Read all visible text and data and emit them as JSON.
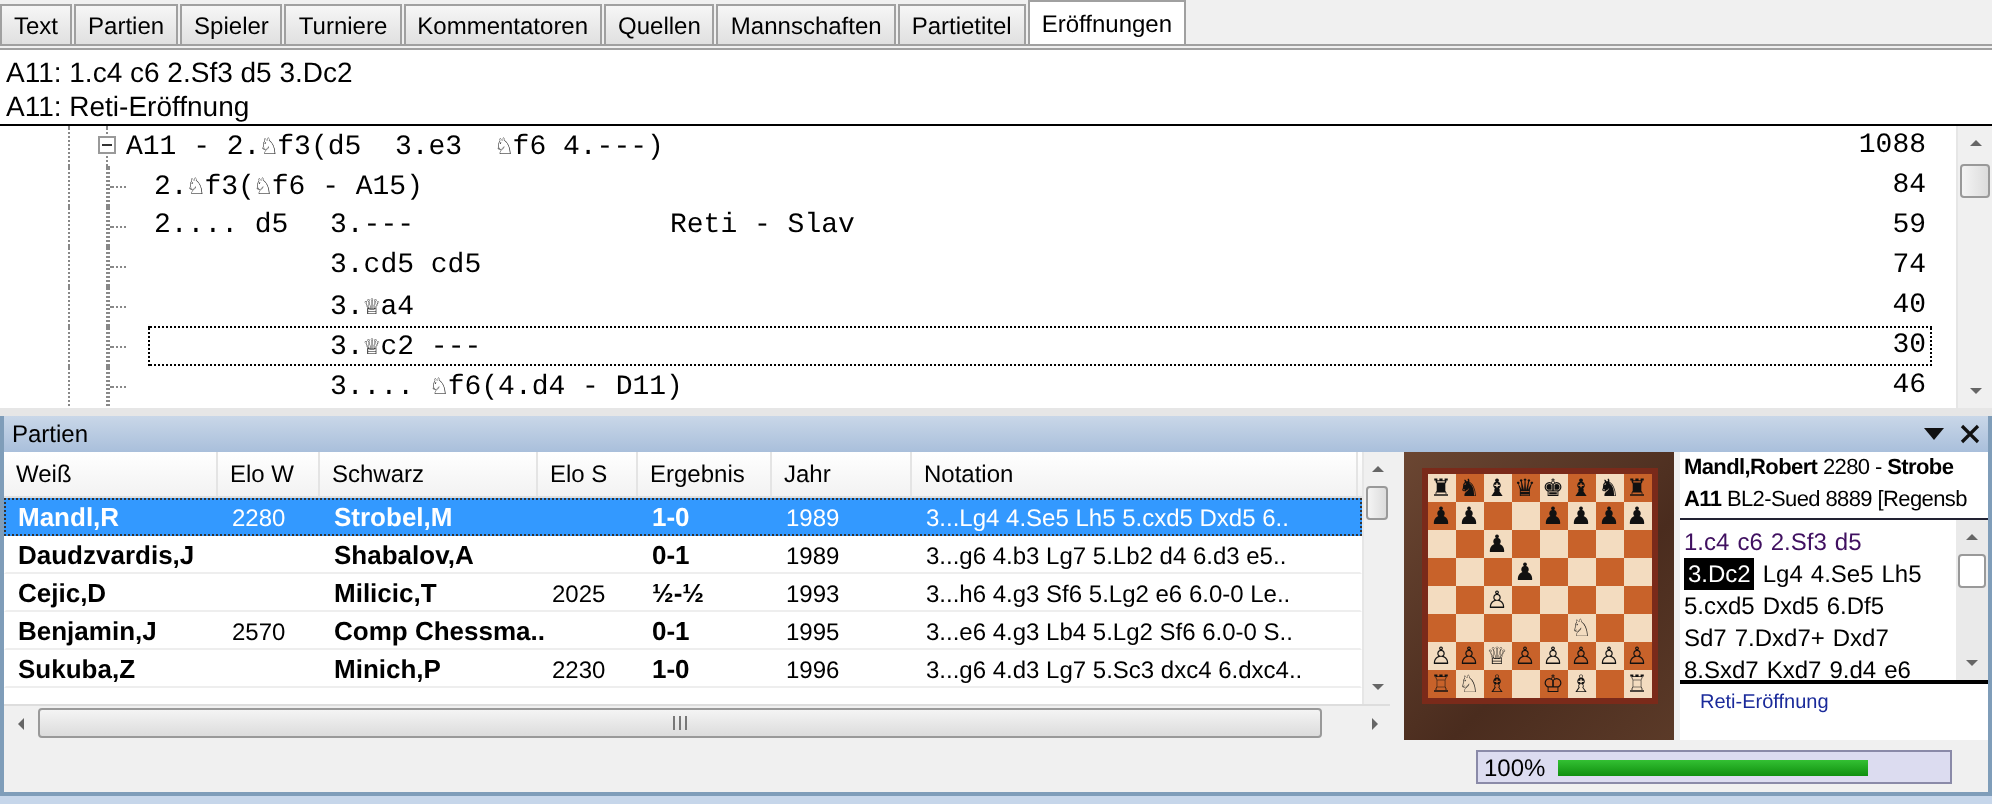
{
  "tabs": [
    {
      "label": "Text",
      "selected": false
    },
    {
      "label": "Partien",
      "selected": false
    },
    {
      "label": "Spieler",
      "selected": false
    },
    {
      "label": "Turniere",
      "selected": false
    },
    {
      "label": "Kommentatoren",
      "selected": false
    },
    {
      "label": "Quellen",
      "selected": false
    },
    {
      "label": "Mannschaften",
      "selected": false
    },
    {
      "label": "Partietitel",
      "selected": false
    },
    {
      "label": "Eröffnungen",
      "selected": true
    }
  ],
  "header_lines": [
    "A11: 1.c4 c6 2.Sf3 d5 3.Dc2",
    "A11: Reti-Eröffnung"
  ],
  "tree": [
    {
      "text": "A11 - 2.♘f3(d5  3.e3  ♘f6 4.---)",
      "count": "1088",
      "expanded": true,
      "selected": false,
      "children": [
        {
          "text": "2.♘f3(♘f6 - A15)",
          "count": "84",
          "selected": false
        },
        {
          "text": "2.... d5",
          "move": "3.---",
          "name": "Reti - Slav",
          "count": "59",
          "selected": false
        },
        {
          "move": "3.cd5 cd5",
          "count": "74",
          "selected": false
        },
        {
          "move": "3.♕a4",
          "count": "40",
          "selected": false
        },
        {
          "move": "3.♕c2 ---",
          "count": "30",
          "selected": true
        },
        {
          "move": "3.... ♘f6(4.d4 - D11)",
          "count": "46",
          "selected": false
        }
      ]
    }
  ],
  "games_panel": {
    "title": "Partien",
    "columns": [
      "Weiß",
      "Elo W",
      "Schwarz",
      "Elo S",
      "Ergebnis",
      "Jahr",
      "Notation"
    ],
    "rows": [
      {
        "white": "Mandl,R",
        "elo_w": "2280",
        "black": "Strobel,M",
        "result": "1-0",
        "year": "1989",
        "notation": "3...Lg4 4.Se5 Lh5 5.cxd5 Dxd5 6..",
        "selected": true
      },
      {
        "white": "Daudzvardis,J",
        "black": "Shabalov,A",
        "result": "0-1",
        "year": "1989",
        "notation": "3...g6 4.b3 Lg7 5.Lb2 d4 6.d3 e5..",
        "selected": false
      },
      {
        "white": "Cejic,D",
        "black": "Milicic,T",
        "elo_s": "2025",
        "result": "½-½",
        "year": "1993",
        "notation": "3...h6 4.g3 Sf6 5.Lg2 e6 6.0-0 Le..",
        "selected": false
      },
      {
        "white": "Benjamin,J",
        "elo_w": "2570",
        "black": "Comp Chessma..",
        "result": "0-1",
        "year": "1995",
        "notation": "3...e6 4.g3 Lb4 5.Lg2 Sf6 6.0-0 S..",
        "selected": false
      },
      {
        "white": "Sukuba,Z",
        "black": "Minich,P",
        "elo_s": "2230",
        "result": "1-0",
        "year": "1996",
        "notation": "3...g6 4.d3 Lg7 5.Sc3 dxc4 6.dxc4..",
        "selected": false
      }
    ]
  },
  "board": {
    "ranks": [
      "♜♞♝♛♚♝♞♜",
      "♟♟  ♟♟♟♟",
      "  ♟     ",
      "   ♟    ",
      "  ♙     ",
      "     ♘  ",
      "♙♙♕♙♙♙♙♙",
      "♖♘♗ ♔♗ ♖"
    ]
  },
  "game_header": [
    "**Mandl,Robert** 2280 - **Strobe**",
    "**A11** BL2-Sued 8889 [Regensb"
  ],
  "moves": [
    [
      {
        "text": "1.c4",
        "played": true,
        "selected": false
      },
      {
        "text": "c6",
        "played": true,
        "selected": false
      },
      {
        "text": "2.Sf3",
        "played": true,
        "selected": false
      },
      {
        "text": "d5",
        "played": true,
        "selected": false
      }
    ],
    [
      {
        "text": "3.Dc2",
        "played": true,
        "selected": true
      },
      {
        "text": "Lg4",
        "played": false,
        "selected": false
      },
      {
        "text": "4.Se5",
        "played": false,
        "selected": false
      },
      {
        "text": "Lh5",
        "played": false,
        "selected": false
      }
    ],
    [
      {
        "text": "5.cxd5",
        "played": false,
        "selected": false
      },
      {
        "text": "Dxd5",
        "played": false,
        "selected": false
      },
      {
        "text": "6.Df5",
        "played": false,
        "selected": false
      }
    ],
    [
      {
        "text": "Sd7",
        "played": false,
        "selected": false
      },
      {
        "text": "7.Dxd7+",
        "played": false,
        "selected": false
      },
      {
        "text": "Dxd7",
        "played": false,
        "selected": false
      }
    ],
    [
      {
        "text": "8.Sxd7",
        "played": false,
        "selected": false
      },
      {
        "text": "Kxd7",
        "played": false,
        "selected": false
      },
      {
        "text": "9.d4",
        "played": false,
        "selected": false
      },
      {
        "text": "e6",
        "played": false,
        "selected": false
      }
    ]
  ],
  "opening": "Reti-Eröffnung",
  "progress": {
    "label": "100%",
    "level": 1
  }
}
